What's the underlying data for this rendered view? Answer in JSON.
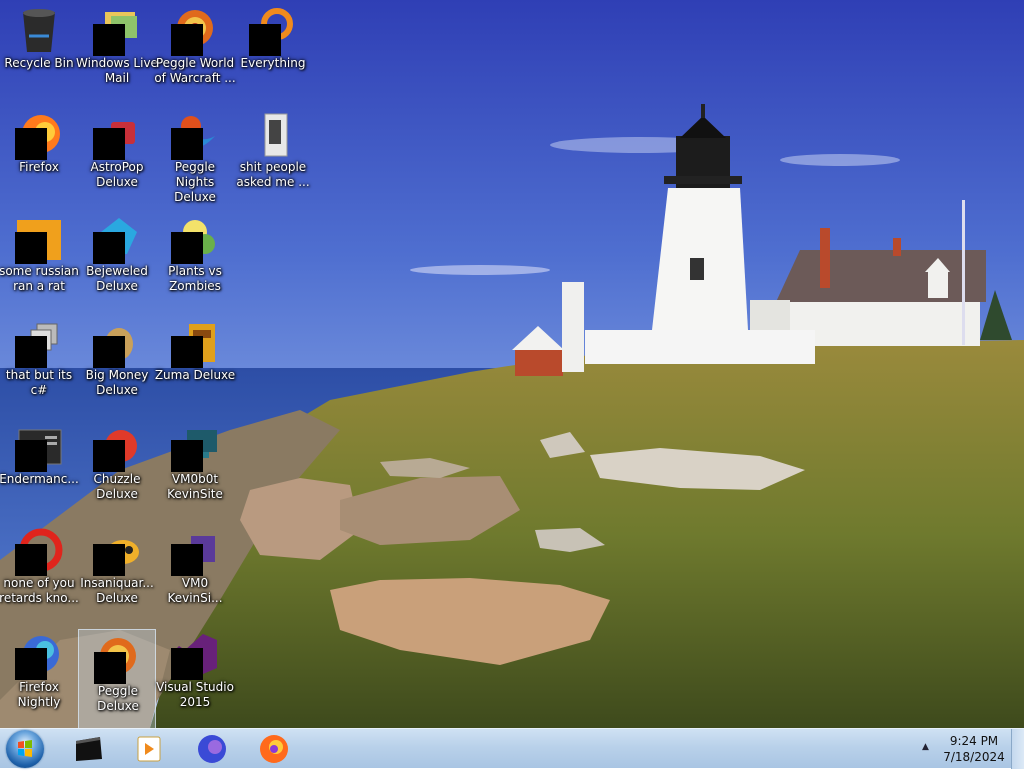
{
  "desktop": {
    "icons": [
      {
        "label": "Recycle Bin",
        "icon": "recycle-bin-icon"
      },
      {
        "label": "Windows Live Mail",
        "icon": "windows-live-mail-icon"
      },
      {
        "label": "Peggle World of Warcraft ...",
        "icon": "peggle-icon"
      },
      {
        "label": "Everything",
        "icon": "everything-search-icon"
      },
      {
        "label": "Firefox",
        "icon": "firefox-icon"
      },
      {
        "label": "AstroPop Deluxe",
        "icon": "astropop-icon"
      },
      {
        "label": "Peggle Nights Deluxe",
        "icon": "peggle-nights-icon"
      },
      {
        "label": "shit people asked me ...",
        "icon": "folder-icon"
      },
      {
        "label": "some russian ran a rat",
        "icon": "java-icon"
      },
      {
        "label": "Bejeweled Deluxe",
        "icon": "bejeweled-icon"
      },
      {
        "label": "Plants vs Zombies",
        "icon": "plants-vs-zombies-icon"
      },
      {
        "label": "that but its c#",
        "icon": "stacked-windows-icon"
      },
      {
        "label": "Big Money Deluxe",
        "icon": "money-bag-icon"
      },
      {
        "label": "Zuma Deluxe",
        "icon": "zuma-icon"
      },
      {
        "label": "Endermanc...",
        "icon": "console-icon"
      },
      {
        "label": "Chuzzle Deluxe",
        "icon": "chuzzle-icon"
      },
      {
        "label": "VM0b0t KevinSite",
        "icon": "vm-terminal-icon"
      },
      {
        "label": "none of you retards kno...",
        "icon": "opera-icon"
      },
      {
        "label": "Insaniquar... Deluxe",
        "icon": "insaniquarium-icon"
      },
      {
        "label": "VM0 KevinSi...",
        "icon": "vm-icon"
      },
      {
        "label": "Firefox Nightly",
        "icon": "firefox-nightly-icon"
      },
      {
        "label": "Peggle Deluxe",
        "icon": "peggle-icon"
      },
      {
        "label": "Visual Studio 2015",
        "icon": "visual-studio-icon"
      }
    ]
  },
  "taskbar": {
    "start": "start-orb-icon",
    "pinned": [
      {
        "name": "command-prompt-icon"
      },
      {
        "name": "media-player-icon"
      },
      {
        "name": "firefox-nightly-icon"
      },
      {
        "name": "firefox-icon"
      }
    ],
    "tray_chevron": "▲",
    "time": "9:24 PM",
    "date": "7/18/2024"
  }
}
